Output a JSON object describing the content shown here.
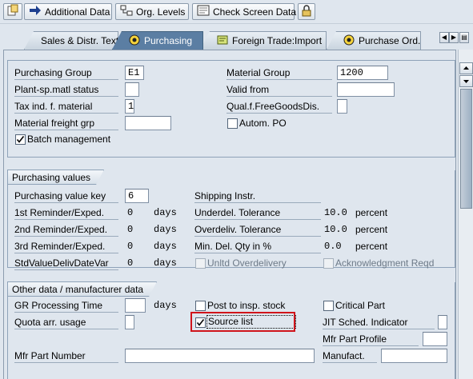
{
  "toolbar": {
    "additional_data": "Additional Data",
    "org_levels": "Org. Levels",
    "check_screen_data": "Check Screen Data"
  },
  "tabs": [
    {
      "label": "Sales & Distr. Text"
    },
    {
      "label": "Purchasing"
    },
    {
      "label": "Foreign Trade:Import"
    },
    {
      "label": "Purchase Ord..."
    }
  ],
  "general": {
    "purchasing_group": {
      "label": "Purchasing Group",
      "value": "E1"
    },
    "plant_sp_matl_status": {
      "label": "Plant-sp.matl status",
      "value": ""
    },
    "tax_ind": {
      "label": "Tax ind. f. material",
      "value": "1"
    },
    "material_freight_grp": {
      "label": "Material freight grp",
      "value": ""
    },
    "batch_management": {
      "label": "Batch management",
      "checked": true
    },
    "material_group": {
      "label": "Material Group",
      "value": "1200"
    },
    "valid_from": {
      "label": "Valid from",
      "value": ""
    },
    "qual_free_goods": {
      "label": "Qual.f.FreeGoodsDis.",
      "value": ""
    },
    "autom_po": {
      "label": "Autom. PO",
      "checked": false
    }
  },
  "purchasing_values": {
    "title": "Purchasing values",
    "value_key": {
      "label": "Purchasing value key",
      "value": "6"
    },
    "reminder1": {
      "label": "1st Reminder/Exped.",
      "value": "0",
      "unit": "days"
    },
    "reminder2": {
      "label": "2nd Reminder/Exped.",
      "value": "0",
      "unit": "days"
    },
    "reminder3": {
      "label": "3rd Reminder/Exped.",
      "value": "0",
      "unit": "days"
    },
    "std_value": {
      "label": "StdValueDelivDateVar",
      "value": "0",
      "unit": "days"
    },
    "shipping_instr": {
      "label": "Shipping Instr."
    },
    "underdel": {
      "label": "Underdel. Tolerance",
      "value": "10.0",
      "unit": "percent"
    },
    "overdel": {
      "label": "Overdeliv. Tolerance",
      "value": "10.0",
      "unit": "percent"
    },
    "min_del_qty": {
      "label": "Min. Del. Qty in %",
      "value": "0.0",
      "unit": "percent"
    },
    "unltd_overdelivery": {
      "label": "Unltd Overdelivery",
      "checked": false
    },
    "ack_reqd": {
      "label": "Acknowledgment Reqd",
      "checked": false
    }
  },
  "other_data": {
    "title": "Other data / manufacturer data",
    "gr_processing_time": {
      "label": "GR Processing Time",
      "value": "",
      "unit": "days"
    },
    "quota_arr_usage": {
      "label": "Quota arr. usage",
      "value": ""
    },
    "post_to_insp_stock": {
      "label": "Post to insp. stock",
      "checked": false
    },
    "source_list": {
      "label": "Source list",
      "checked": true
    },
    "critical_part": {
      "label": "Critical Part",
      "checked": false
    },
    "jit_sched": {
      "label": "JIT Sched. Indicator",
      "value": ""
    },
    "mfr_part_profile": {
      "label": "Mfr Part Profile",
      "value": ""
    },
    "mfr_part_number": {
      "label": "Mfr Part Number",
      "value": ""
    },
    "manufact": {
      "label": "Manufact.",
      "value": ""
    }
  },
  "colors": {
    "active_tab": "#5b7ea3",
    "highlight_border": "#d0141b",
    "background": "#dfe6ee"
  },
  "icons": [
    "create-icon",
    "arrow-right-icon",
    "org-levels-icon",
    "check-screen-icon",
    "lock-icon",
    "tab-page-icon",
    "scroll-left-icon",
    "scroll-right-icon",
    "tab-list-icon",
    "scroll-up-icon",
    "scroll-down-icon",
    "checkmark-icon"
  ]
}
